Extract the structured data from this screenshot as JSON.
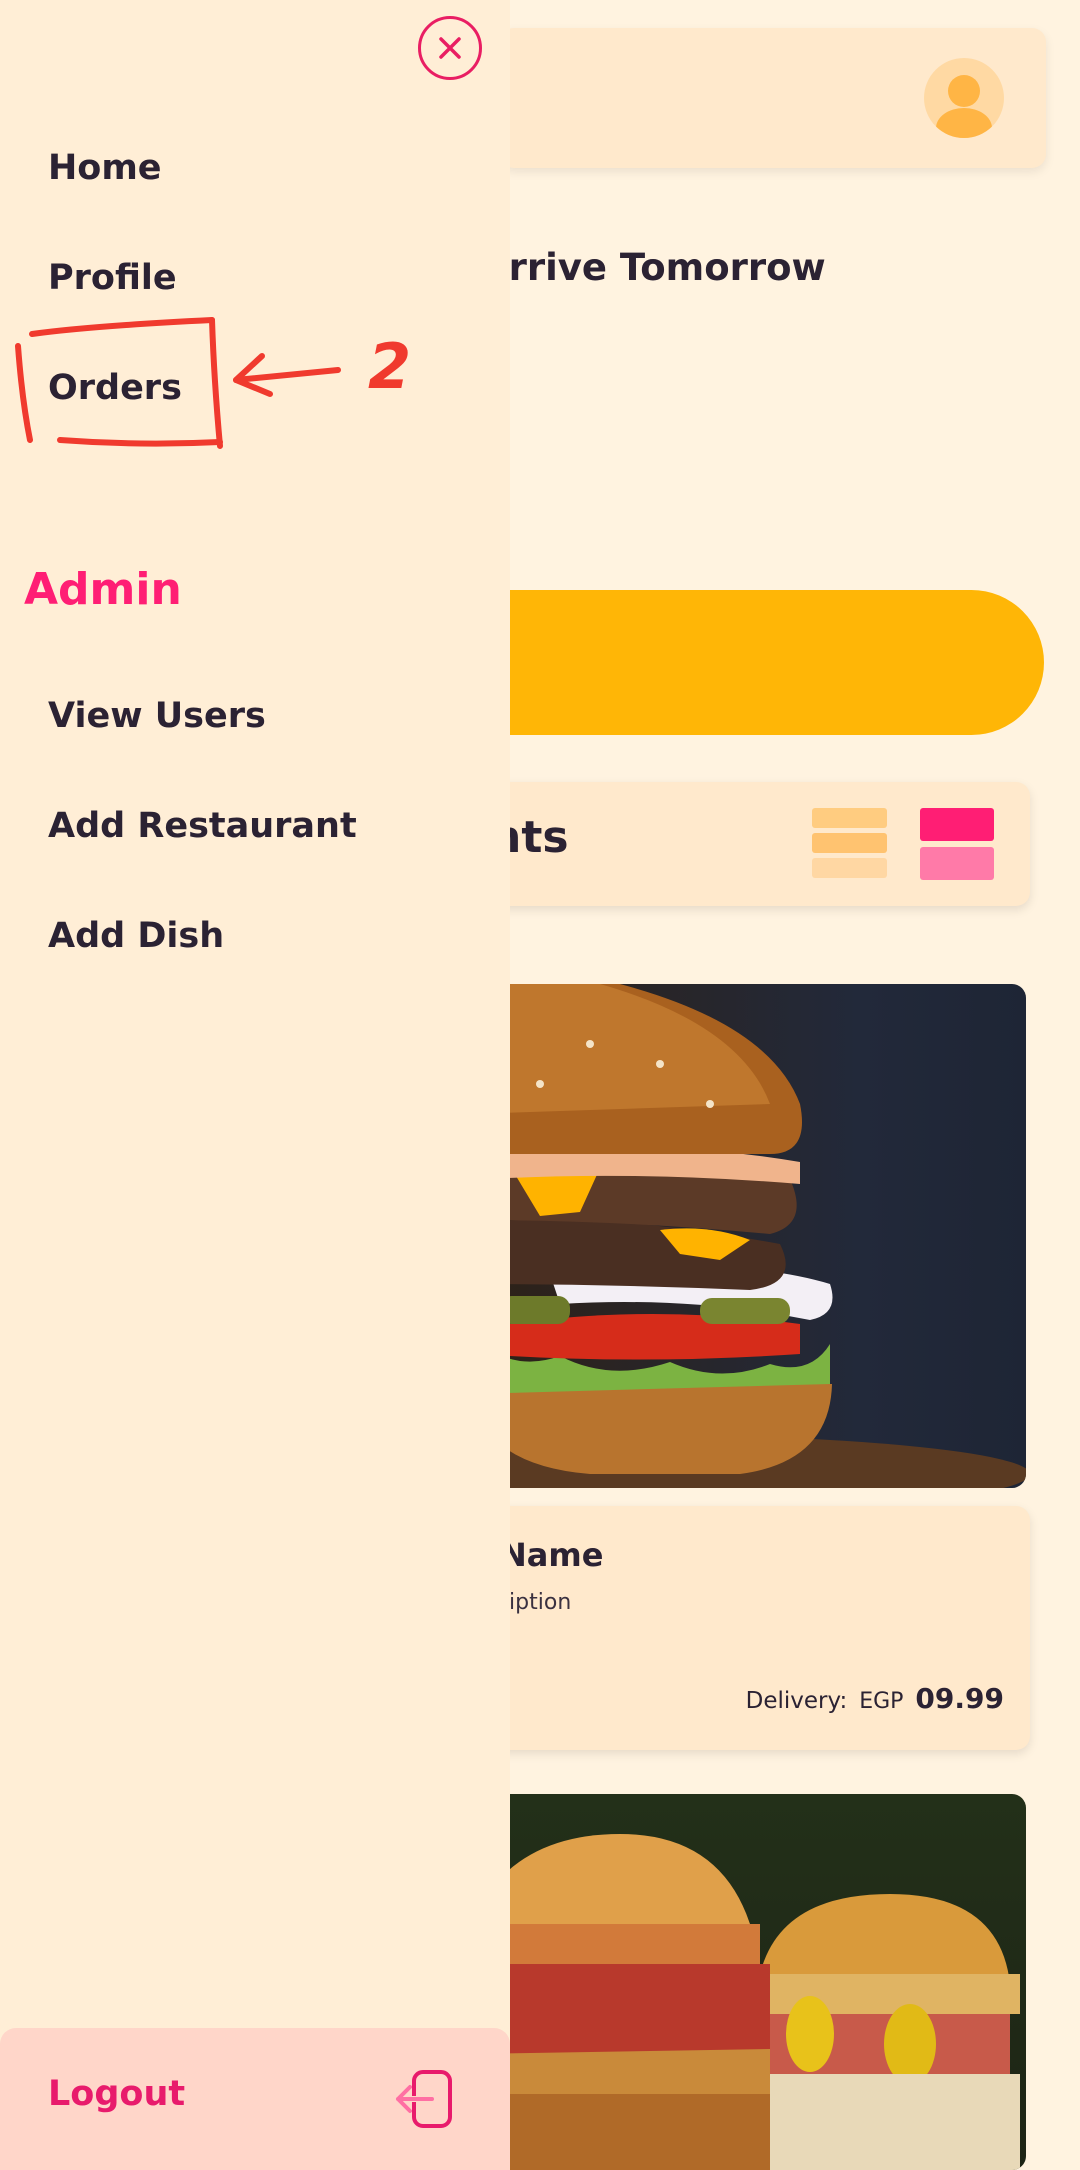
{
  "background": {
    "delivery_banner": "Arrive Tomorrow",
    "section_title": "nts",
    "card": {
      "name": "Name",
      "description": "ription",
      "delivery_label": "Delivery:",
      "currency": "EGP",
      "delivery_value": "09.99"
    }
  },
  "drawer": {
    "nav_items": [
      {
        "label": "Home"
      },
      {
        "label": "Profile"
      },
      {
        "label": "Orders"
      }
    ],
    "admin_heading": "Admin",
    "admin_items": [
      {
        "label": "View Users"
      },
      {
        "label": "Add Restaurant"
      },
      {
        "label": "Add Dish"
      }
    ],
    "logout_label": "Logout"
  },
  "annotation": {
    "label": "2",
    "color": "#F03A2E"
  },
  "colors": {
    "accent": "#FF1E74",
    "cta": "#FFB606",
    "drawer_bg": "#FFEED6",
    "page_bg": "#FFF3E0"
  },
  "icons": [
    "close-icon",
    "user-avatar-icon",
    "list-view-icon",
    "grid-view-icon",
    "logout-icon"
  ]
}
